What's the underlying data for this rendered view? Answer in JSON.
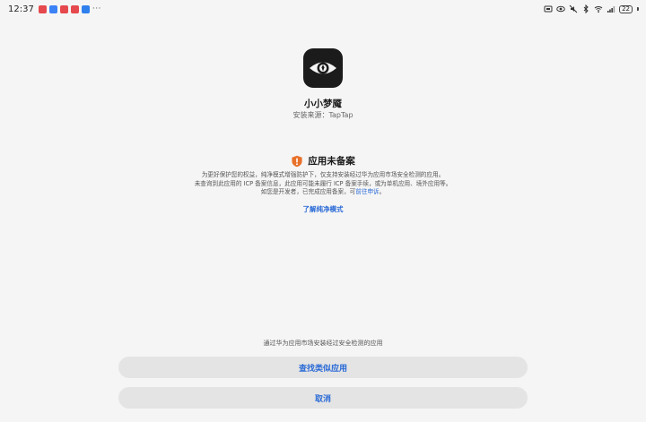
{
  "status_bar": {
    "time": "12:37",
    "more": "···",
    "notification_colors": [
      "#e5484d",
      "#3b82f6",
      "#e5484d",
      "#e5484d",
      "#2f80ed"
    ],
    "battery": "22"
  },
  "app": {
    "name": "小小梦魇",
    "source": "安装来源：TapTap",
    "icon": "eye-icon"
  },
  "warning": {
    "title": "应用未备案",
    "icon": "warning-shield-icon",
    "line1": "为更好保护您的权益，纯净模式增强防护下，仅支持安装经过华为应用市场安全检测的应用。",
    "line2": "未查询到此应用的 ICP 备案信息，此应用可能未履行 ICP 备案手续，或为单机应用、境外应用等。",
    "line3": "如您是开发者，已完成应用备案，可",
    "appeal": "前往申诉",
    "line3_end": "。"
  },
  "learn_more": "了解纯净模式",
  "hint": "通过华为应用市场安装经过安全检测的应用",
  "buttons": {
    "find_similar": "查找类似应用",
    "cancel": "取消"
  },
  "colors": {
    "accent": "#2a6ad6",
    "warning": "#e8712a",
    "background": "#f5f5f5",
    "button_bg": "#e4e4e4"
  }
}
